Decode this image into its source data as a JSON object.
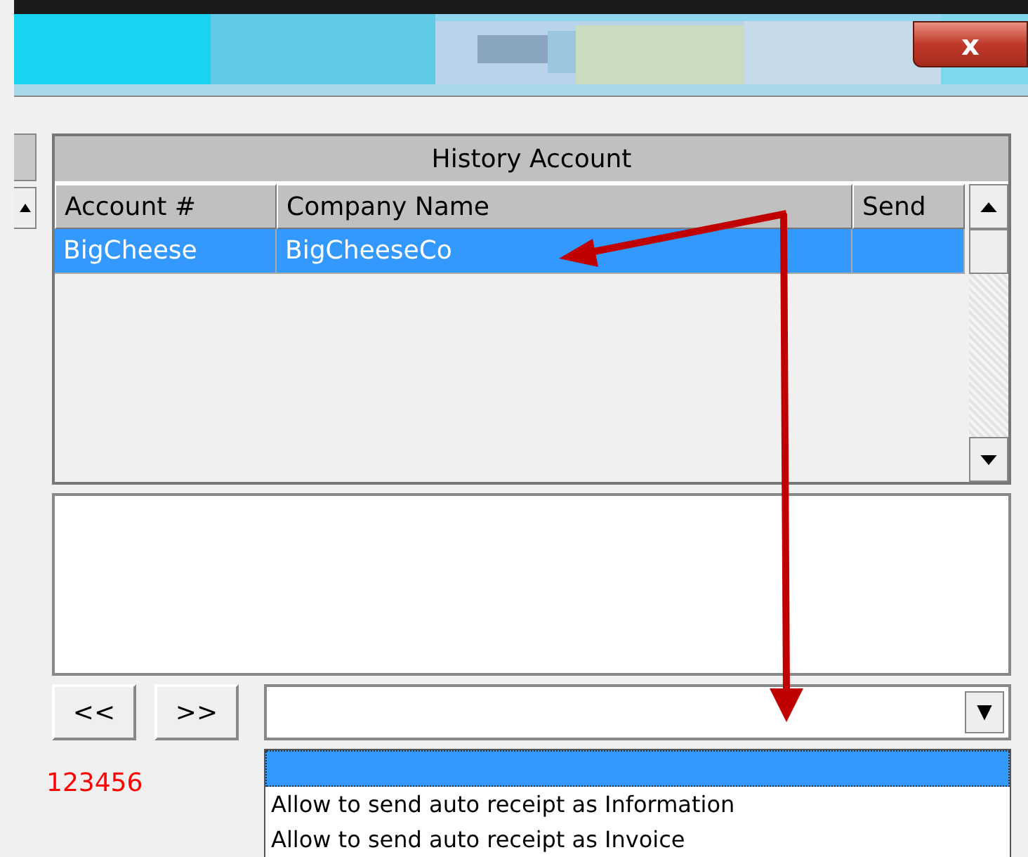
{
  "window": {
    "close": "x"
  },
  "table": {
    "title": "History Account",
    "columns": [
      "Account #",
      "Company Name",
      "Send"
    ],
    "rows": [
      {
        "cells": [
          "BigCheese",
          "BigCheeseCo",
          ""
        ],
        "selected": true
      }
    ]
  },
  "nav_buttons": [
    "<<",
    ">>"
  ],
  "combo": {
    "arrow": "▼",
    "options": [
      {
        "selected": true
      },
      {
        "label": "Allow to send auto receipt as Information",
        "selected": false
      },
      {
        "label": "Allow to send auto receipt as Invoice",
        "selected": false
      }
    ]
  },
  "status_code": "123456"
}
